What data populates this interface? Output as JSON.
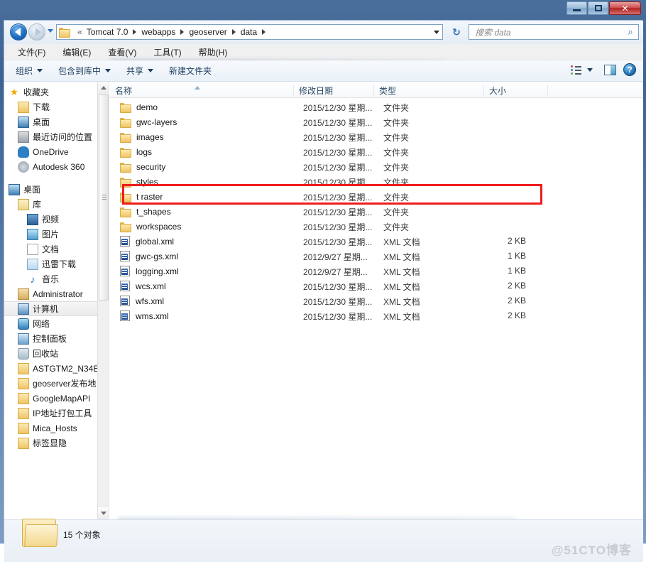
{
  "window": {
    "title": "",
    "controls": {
      "minimize": "–",
      "maximize": "❐",
      "close": "✕"
    }
  },
  "nav": {
    "back_icon": "back-arrow-icon",
    "forward_icon": "forward-arrow-icon",
    "recent_icon": "recent-pages-icon",
    "refresh_icon": "refresh-icon",
    "breadcrumb_prefix": "«",
    "breadcrumbs": [
      "Tomcat 7.0",
      "webapps",
      "geoserver",
      "data"
    ],
    "search": {
      "placeholder": "搜索 data",
      "value": "",
      "icon": "search-icon"
    }
  },
  "menubar": {
    "items": [
      "文件(F)",
      "编辑(E)",
      "查看(V)",
      "工具(T)",
      "帮助(H)"
    ]
  },
  "toolbar": {
    "items": [
      {
        "label": "组织",
        "has_caret": true
      },
      {
        "label": "包含到库中",
        "has_caret": true
      },
      {
        "label": "共享",
        "has_caret": true
      },
      {
        "label": "新建文件夹",
        "has_caret": false
      }
    ],
    "view_icon": "view-options-icon",
    "view_caret": "chevron-down-icon",
    "preview_pane_icon": "preview-pane-icon",
    "help_icon": "help-icon",
    "help_glyph": "?"
  },
  "sidebar": {
    "items": [
      {
        "label": "收藏夹",
        "icon": "favorites-star-icon",
        "indent": 0,
        "selected": false
      },
      {
        "label": "下载",
        "icon": "downloads-icon",
        "indent": 1,
        "selected": false
      },
      {
        "label": "桌面",
        "icon": "desktop-icon",
        "indent": 1,
        "selected": false
      },
      {
        "label": "最近访问的位置",
        "icon": "recent-places-icon",
        "indent": 1,
        "selected": false
      },
      {
        "label": "OneDrive",
        "icon": "onedrive-cloud-icon",
        "indent": 1,
        "selected": false
      },
      {
        "label": "Autodesk 360",
        "icon": "autodesk-icon",
        "indent": 1,
        "selected": false
      },
      {
        "label": "__GAP__",
        "icon": "",
        "indent": 0,
        "selected": false
      },
      {
        "label": "桌面",
        "icon": "desktop-icon",
        "indent": 0,
        "selected": false
      },
      {
        "label": "库",
        "icon": "library-icon",
        "indent": 1,
        "selected": false
      },
      {
        "label": "视频",
        "icon": "videos-icon",
        "indent": 2,
        "selected": false
      },
      {
        "label": "图片",
        "icon": "pictures-icon",
        "indent": 2,
        "selected": false
      },
      {
        "label": "文档",
        "icon": "documents-icon",
        "indent": 2,
        "selected": false
      },
      {
        "label": "迅雷下载",
        "icon": "thunder-download-icon",
        "indent": 2,
        "selected": false
      },
      {
        "label": "音乐",
        "icon": "music-note-icon",
        "indent": 2,
        "selected": false
      },
      {
        "label": "Administrator",
        "icon": "user-account-icon",
        "indent": 1,
        "selected": false
      },
      {
        "label": "计算机",
        "icon": "computer-icon",
        "indent": 1,
        "selected": true
      },
      {
        "label": "网络",
        "icon": "network-icon",
        "indent": 1,
        "selected": false
      },
      {
        "label": "控制面板",
        "icon": "control-panel-icon",
        "indent": 1,
        "selected": false
      },
      {
        "label": "回收站",
        "icon": "recycle-bin-icon",
        "indent": 1,
        "selected": false
      },
      {
        "label": "ASTGTM2_N34E",
        "icon": "folder-icon",
        "indent": 1,
        "selected": false
      },
      {
        "label": "geoserver发布地",
        "icon": "folder-icon",
        "indent": 1,
        "selected": false
      },
      {
        "label": "GoogleMapAPI",
        "icon": "folder-icon",
        "indent": 1,
        "selected": false
      },
      {
        "label": "IP地址打包工具",
        "icon": "folder-icon",
        "indent": 1,
        "selected": false
      },
      {
        "label": "Mica_Hosts",
        "icon": "folder-icon",
        "indent": 1,
        "selected": false
      },
      {
        "label": "标签显隐",
        "icon": "folder-icon",
        "indent": 1,
        "selected": false
      }
    ],
    "scrollbar": {
      "up_icon": "scroll-up-icon",
      "down_icon": "scroll-down-icon"
    }
  },
  "filelist": {
    "columns": [
      "名称",
      "修改日期",
      "类型",
      "大小"
    ],
    "sort_column": "名称",
    "sort_direction": "asc",
    "rows": [
      {
        "name": "demo",
        "icon": "folder-icon",
        "date": "2015/12/30 星期...",
        "type": "文件夹",
        "size": ""
      },
      {
        "name": "gwc-layers",
        "icon": "folder-icon",
        "date": "2015/12/30 星期...",
        "type": "文件夹",
        "size": ""
      },
      {
        "name": "images",
        "icon": "folder-icon",
        "date": "2015/12/30 星期...",
        "type": "文件夹",
        "size": ""
      },
      {
        "name": "logs",
        "icon": "folder-icon",
        "date": "2015/12/30 星期...",
        "type": "文件夹",
        "size": ""
      },
      {
        "name": "security",
        "icon": "folder-icon",
        "date": "2015/12/30 星期...",
        "type": "文件夹",
        "size": ""
      },
      {
        "name": "styles",
        "icon": "folder-icon",
        "date": "2015/12/30 星期...",
        "type": "文件夹",
        "size": ""
      },
      {
        "name": "t raster",
        "icon": "folder-icon",
        "date": "2015/12/30 星期...",
        "type": "文件夹",
        "size": ""
      },
      {
        "name": "t_shapes",
        "icon": "folder-icon",
        "date": "2015/12/30 星期...",
        "type": "文件夹",
        "size": "",
        "highlighted": true
      },
      {
        "name": "workspaces",
        "icon": "folder-icon",
        "date": "2015/12/30 星期...",
        "type": "文件夹",
        "size": ""
      },
      {
        "name": "global.xml",
        "icon": "xml-file-icon",
        "date": "2015/12/30 星期...",
        "type": "XML 文档",
        "size": "2 KB"
      },
      {
        "name": "gwc-gs.xml",
        "icon": "xml-file-icon",
        "date": "2012/9/27 星期...",
        "type": "XML 文档",
        "size": "1 KB"
      },
      {
        "name": "logging.xml",
        "icon": "xml-file-icon",
        "date": "2012/9/27 星期...",
        "type": "XML 文档",
        "size": "1 KB"
      },
      {
        "name": "wcs.xml",
        "icon": "xml-file-icon",
        "date": "2015/12/30 星期...",
        "type": "XML 文档",
        "size": "2 KB"
      },
      {
        "name": "wfs.xml",
        "icon": "xml-file-icon",
        "date": "2015/12/30 星期...",
        "type": "XML 文档",
        "size": "2 KB"
      },
      {
        "name": "wms.xml",
        "icon": "xml-file-icon",
        "date": "2015/12/30 星期...",
        "type": "XML 文档",
        "size": "2 KB"
      }
    ],
    "highlight_color": "#ef1c1c"
  },
  "statusbar": {
    "folder_icon": "large-folder-icon",
    "item_count_text": "15 个对象",
    "watermark": "@51CTO博客"
  }
}
